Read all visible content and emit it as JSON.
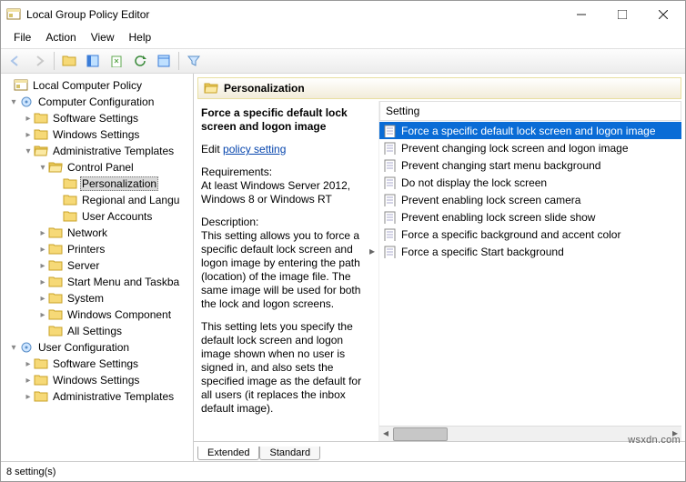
{
  "window": {
    "title": "Local Group Policy Editor"
  },
  "menu": [
    "File",
    "Action",
    "View",
    "Help"
  ],
  "tree_root": "Local Computer Policy",
  "tree": [
    {
      "d": 0,
      "e": "open",
      "t": "cfg",
      "l": "Computer Configuration"
    },
    {
      "d": 1,
      "e": "closed",
      "t": "f",
      "l": "Software Settings"
    },
    {
      "d": 1,
      "e": "closed",
      "t": "f",
      "l": "Windows Settings"
    },
    {
      "d": 1,
      "e": "open",
      "t": "f",
      "l": "Administrative Templates"
    },
    {
      "d": 2,
      "e": "open",
      "t": "f",
      "l": "Control Panel"
    },
    {
      "d": 3,
      "e": "leaf",
      "t": "f",
      "l": "Personalization",
      "sel": true
    },
    {
      "d": 3,
      "e": "leaf",
      "t": "f",
      "l": "Regional and Langu"
    },
    {
      "d": 3,
      "e": "leaf",
      "t": "f",
      "l": "User Accounts"
    },
    {
      "d": 2,
      "e": "closed",
      "t": "f",
      "l": "Network"
    },
    {
      "d": 2,
      "e": "closed",
      "t": "f",
      "l": "Printers"
    },
    {
      "d": 2,
      "e": "closed",
      "t": "f",
      "l": "Server"
    },
    {
      "d": 2,
      "e": "closed",
      "t": "f",
      "l": "Start Menu and Taskba"
    },
    {
      "d": 2,
      "e": "closed",
      "t": "f",
      "l": "System"
    },
    {
      "d": 2,
      "e": "closed",
      "t": "f",
      "l": "Windows Component"
    },
    {
      "d": 2,
      "e": "leaf",
      "t": "f",
      "l": "All Settings"
    },
    {
      "d": 0,
      "e": "open",
      "t": "cfg",
      "l": "User Configuration"
    },
    {
      "d": 1,
      "e": "closed",
      "t": "f",
      "l": "Software Settings"
    },
    {
      "d": 1,
      "e": "closed",
      "t": "f",
      "l": "Windows Settings"
    },
    {
      "d": 1,
      "e": "closed",
      "t": "f",
      "l": "Administrative Templates"
    }
  ],
  "pane": {
    "heading": "Personalization",
    "title": "Force a specific default lock screen and logon image",
    "edit_prefix": "Edit ",
    "edit_link": "policy setting",
    "req_label": "Requirements:",
    "req_text": "At least Windows Server 2012, Windows 8 or Windows RT",
    "desc_label": "Description:",
    "desc1": "This setting allows you to force a specific default lock screen and logon image by entering the path (location) of the image file. The same image will be used for both the lock and logon screens.",
    "desc2": "This setting lets you specify the default lock screen and logon image shown when no user is signed in, and also sets the specified image as the default for all users (it replaces the inbox default image)."
  },
  "list": {
    "header": "Setting",
    "items": [
      "Force a specific default lock screen and logon image",
      "Prevent changing lock screen and logon image",
      "Prevent changing start menu background",
      "Do not display the lock screen",
      "Prevent enabling lock screen camera",
      "Prevent enabling lock screen slide show",
      "Force a specific background and accent color",
      "Force a specific Start background"
    ],
    "selected": 0
  },
  "tabs": [
    "Extended",
    "Standard"
  ],
  "status": "8 setting(s)",
  "watermark": "wsxdn.com"
}
